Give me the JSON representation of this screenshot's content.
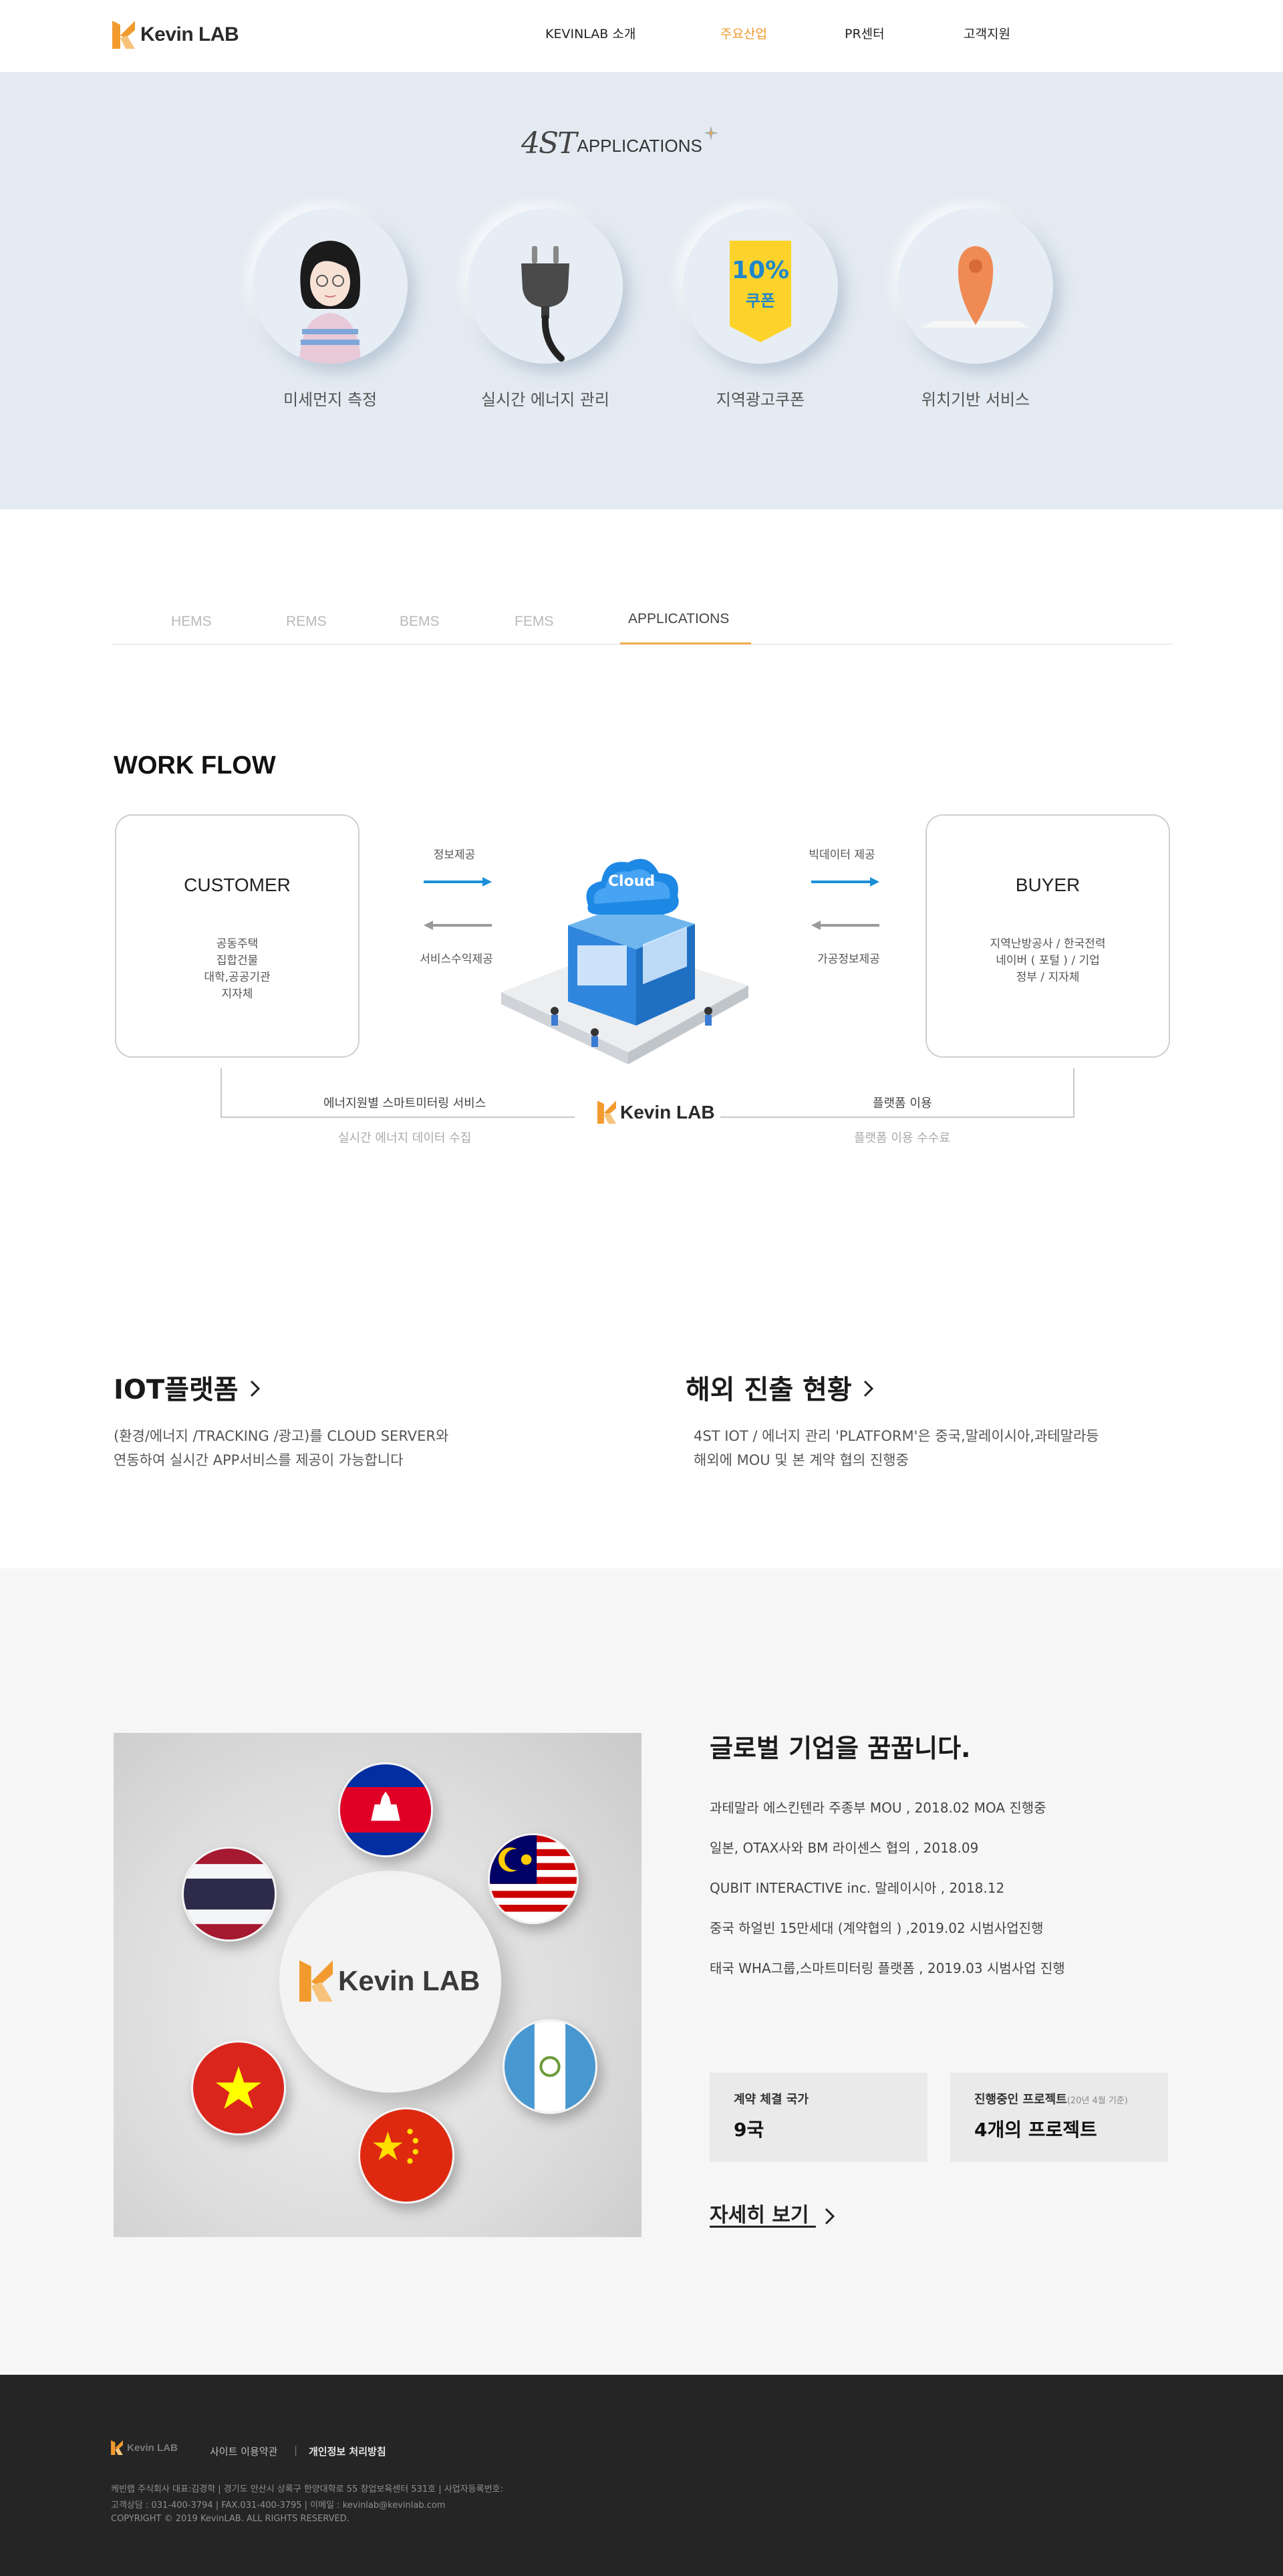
{
  "header": {
    "logo_text": "Kevin LAB",
    "nav": [
      "KEVINLAB 소개",
      "주요산업",
      "PR센터",
      "고객지원"
    ],
    "active_nav": "주요산업"
  },
  "hero": {
    "title_big": "4ST",
    "title_small": "APPLICATIONS",
    "items": [
      {
        "label": "미세먼지 측정",
        "icon": "woman-avatar-icon"
      },
      {
        "label": "실시간 에너지 관리",
        "icon": "power-plug-icon"
      },
      {
        "label": "지역광고쿠폰",
        "icon": "coupon-tag-icon",
        "coupon_percent": "10%",
        "coupon_word": "쿠폰"
      },
      {
        "label": "위치기반 서비스",
        "icon": "location-pin-icon"
      }
    ]
  },
  "tabs": [
    "HEMS",
    "REMS",
    "BEMS",
    "FEMS",
    "APPLICATIONS"
  ],
  "active_tab": "APPLICATIONS",
  "workflow": {
    "title": "WORK FLOW",
    "customer": {
      "title": "CUSTOMER",
      "lines": [
        "공동주택",
        "집합건물",
        "대학,공공기관",
        "지자체"
      ]
    },
    "buyer": {
      "title": "BUYER",
      "lines": [
        "지역난방공사 / 한국전력",
        "네이버 ( 포털 ) / 기업",
        "정부 / 지자체"
      ]
    },
    "left_top_label": "정보제공",
    "left_bottom_label": "서비스수익제공",
    "right_top_label": "빅데이터 제공",
    "right_bottom_label": "가공정보제공",
    "cloud_label": "Cloud",
    "bottom_left_label": "에너지원별 스마트미터링 서비스",
    "bottom_left_sub": "실시간 에너지 데이터 수집",
    "bottom_right_label": "플랫폼 이용",
    "bottom_right_sub": "플랫폼 이용 수수료",
    "center_logo": "Kevin LAB",
    "colors": {
      "blue_arrow": "#1a8fd6",
      "gray_arrow": "#9a9a9a"
    }
  },
  "iot": {
    "title": "IOT플랫폼",
    "lines": [
      "(환경/에너지 /TRACKING /광고)를  CLOUD SERVER와",
      "연동하여 실시간 APP서비스를 제공이 가능합니다"
    ]
  },
  "overseas": {
    "title": "해외 진출 현황",
    "lines": [
      "4ST IOT / 에너지 관리 'PLATFORM'은 중국,말레이시아,과테말라등",
      "해외에 MOU 및 본 계약 협의 진행중"
    ]
  },
  "global": {
    "title": "글로벌 기업을 꿈꿉니다.",
    "image_logo": "Kevin LAB",
    "items": [
      "과테말라 에스킨텐라 주종부 MOU , 2018.02 MOA 진행중",
      "일본, OTAX사와 BM 라이센스 협의 , 2018.09",
      "QUBIT INTERACTIVE inc. 말레이시아 , 2018.12",
      "중국 하얼빈 15만세대 (계약협의 ) ,2019.02 시범사업진행",
      "태국 WHA그룹,스마트미터링 플랫폼 , 2019.03 시범사업 진행"
    ],
    "stats": [
      {
        "label": "계약 체결 국가",
        "note": "",
        "value": "9국"
      },
      {
        "label": "진행중인 프로젝트",
        "note": "(20년 4월 기준)",
        "value": "4개의 프로젝트"
      }
    ],
    "more_label": "자세히 보기",
    "flags": [
      "cambodia-flag",
      "thailand-flag",
      "malaysia-flag",
      "guatemala-flag",
      "vietnam-flag",
      "china-flag"
    ]
  },
  "footer": {
    "logo_text": "Kevin LAB",
    "links": [
      "사이트 이용약관",
      "개인정보 처리방침"
    ],
    "line1": "케빈랩 주식회사 대표:김경학    |    경기도 안산시 상록구 한양대학로 55 창업보육센터 531호    |    사업자등록번호:",
    "line2": "고객상담 : 031-400-3794    |    FAX.031-400-3795    |    이메일 : kevinlab@kevinlab.com",
    "line3": "COPYRIGHT © 2019 KevinLAB. ALL RIGHTS RESERVED."
  }
}
